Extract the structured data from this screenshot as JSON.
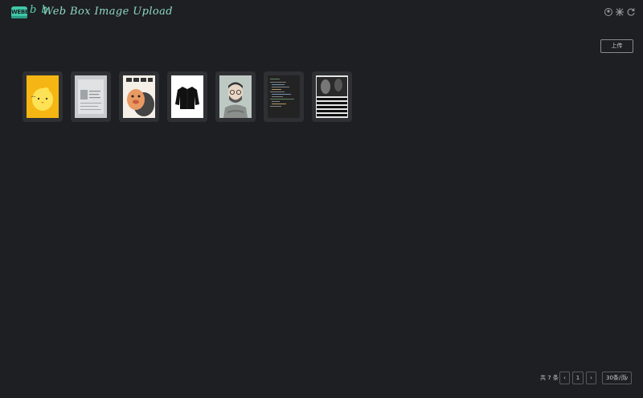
{
  "header": {
    "logo_text": "WEBB",
    "logo_bb": "b b",
    "title": "Web Box Image Upload",
    "icons": [
      "github-icon",
      "settings-icon",
      "refresh-icon"
    ]
  },
  "toolbar": {
    "upload_label": "上传"
  },
  "gallery": {
    "items": [
      {
        "name": "yellow-chick"
      },
      {
        "name": "document-scan"
      },
      {
        "name": "cartoon-meme"
      },
      {
        "name": "black-jacket"
      },
      {
        "name": "bearded-man-illustration"
      },
      {
        "name": "code-screenshot"
      },
      {
        "name": "black-white-collage"
      }
    ]
  },
  "pagination": {
    "total": "共 7 条",
    "prev": "‹",
    "page": "1",
    "next": "›",
    "per_page": "30条/页",
    "per_page_chevron": "∨"
  },
  "colors": {
    "background": "#1e1f22",
    "accent": "#3fc7a8",
    "thumb_bg": "#2f3033"
  }
}
